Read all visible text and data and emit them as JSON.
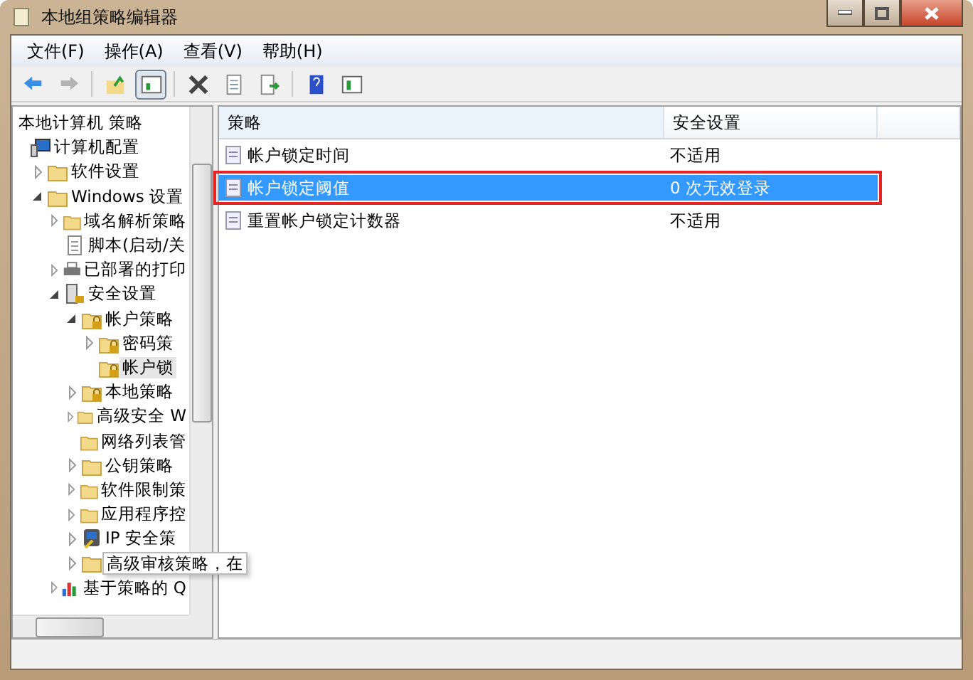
{
  "window": {
    "title": "本地组策略编辑器"
  },
  "menu": [
    "文件(F)",
    "操作(A)",
    "查看(V)",
    "帮助(H)"
  ],
  "toolbar": [
    {
      "kind": "back",
      "disabled": false
    },
    {
      "kind": "forward",
      "disabled": true
    },
    {
      "kind": "sep"
    },
    {
      "kind": "up",
      "disabled": false
    },
    {
      "kind": "tree",
      "disabled": false,
      "pressed": true
    },
    {
      "kind": "sep"
    },
    {
      "kind": "delete",
      "disabled": false
    },
    {
      "kind": "properties",
      "disabled": false
    },
    {
      "kind": "export",
      "disabled": false
    },
    {
      "kind": "sep"
    },
    {
      "kind": "help",
      "disabled": false
    },
    {
      "kind": "view",
      "disabled": false
    }
  ],
  "tree": {
    "root": "本地计算机 策略",
    "items": [
      {
        "label": "计算机配置",
        "kind": "computer",
        "selected": false,
        "children": [
          {
            "label": "软件设置",
            "kind": "folder",
            "expanded": false,
            "selected": false
          },
          {
            "label": "Windows 设置",
            "kind": "folder",
            "expanded": true,
            "selected": false,
            "children": [
              {
                "label": "域名解析策略",
                "kind": "folder",
                "expanded": false,
                "selected": false
              },
              {
                "label": "脚本(启动/关",
                "kind": "script",
                "selected": false
              },
              {
                "label": "已部署的打印",
                "kind": "printer",
                "expanded": false,
                "selected": false
              },
              {
                "label": "安全设置",
                "kind": "security",
                "expanded": true,
                "selected": false,
                "children": [
                  {
                    "label": "帐户策略",
                    "kind": "lock-folder",
                    "expanded": true,
                    "selected": false,
                    "children": [
                      {
                        "label": "密码策",
                        "kind": "lock-folder",
                        "expanded": false,
                        "selected": false
                      },
                      {
                        "label": "帐户锁",
                        "kind": "lock-folder",
                        "selected": true
                      }
                    ]
                  },
                  {
                    "label": "本地策略",
                    "kind": "lock-folder",
                    "expanded": false,
                    "selected": false
                  },
                  {
                    "label": "高级安全 W",
                    "kind": "folder",
                    "expanded": false,
                    "selected": false
                  },
                  {
                    "label": "网络列表管",
                    "kind": "folder",
                    "selected": false
                  },
                  {
                    "label": "公钥策略",
                    "kind": "folder",
                    "expanded": false,
                    "selected": false
                  },
                  {
                    "label": "软件限制策",
                    "kind": "folder",
                    "expanded": false,
                    "selected": false
                  },
                  {
                    "label": "应用程序控",
                    "kind": "folder",
                    "expanded": false,
                    "selected": false
                  },
                  {
                    "label": "IP 安全策",
                    "kind": "ip",
                    "expanded": false,
                    "selected": false
                  },
                  {
                    "label": "高级审核策略，在",
                    "kind": "folder",
                    "expanded": false,
                    "selected": false,
                    "tooltip": true
                  }
                ]
              },
              {
                "label": "基于策略的 Q",
                "kind": "chart",
                "expanded": false,
                "selected": false
              }
            ]
          }
        ]
      }
    ]
  },
  "table": {
    "columns": [
      "策略",
      "安全设置"
    ],
    "rows": [
      {
        "policy": "帐户锁定时间",
        "setting": "不适用",
        "selected": false,
        "highlighted": false
      },
      {
        "policy": "帐户锁定阈值",
        "setting": "0 次无效登录",
        "selected": true,
        "highlighted": true
      },
      {
        "policy": "重置帐户锁定计数器",
        "setting": "不适用",
        "selected": false,
        "highlighted": false
      }
    ]
  }
}
